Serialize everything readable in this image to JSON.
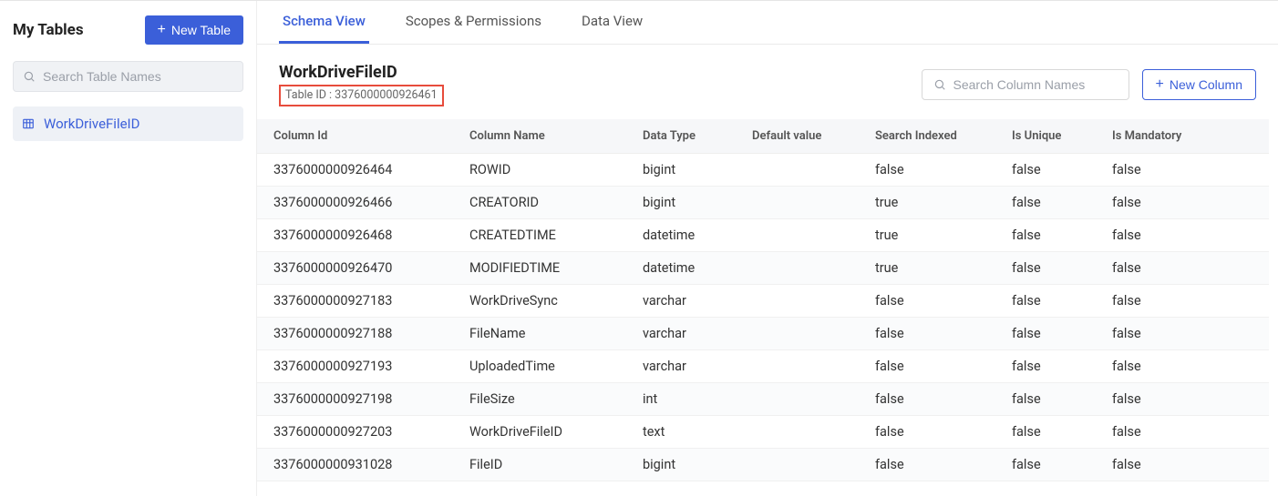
{
  "sidebar": {
    "title": "My Tables",
    "new_btn": "New Table",
    "search_placeholder": "Search Table Names",
    "items": [
      {
        "label": "WorkDriveFileID"
      }
    ]
  },
  "tabs": [
    {
      "label": "Schema View",
      "active": true
    },
    {
      "label": "Scopes & Permissions",
      "active": false
    },
    {
      "label": "Data View",
      "active": false
    }
  ],
  "tableDetail": {
    "name": "WorkDriveFileID",
    "id_label": "Table ID : 3376000000926461"
  },
  "columnSearchPlaceholder": "Search Column Names",
  "newColumnBtn": "New Column",
  "columns": [
    "Column Id",
    "Column Name",
    "Data Type",
    "Default value",
    "Search Indexed",
    "Is Unique",
    "Is Mandatory"
  ],
  "rows": [
    {
      "id": "3376000000926464",
      "name": "ROWID",
      "type": "bigint",
      "default": "",
      "indexed": "false",
      "unique": "false",
      "mandatory": "false"
    },
    {
      "id": "3376000000926466",
      "name": "CREATORID",
      "type": "bigint",
      "default": "",
      "indexed": "true",
      "unique": "false",
      "mandatory": "false"
    },
    {
      "id": "3376000000926468",
      "name": "CREATEDTIME",
      "type": "datetime",
      "default": "",
      "indexed": "true",
      "unique": "false",
      "mandatory": "false"
    },
    {
      "id": "3376000000926470",
      "name": "MODIFIEDTIME",
      "type": "datetime",
      "default": "",
      "indexed": "true",
      "unique": "false",
      "mandatory": "false"
    },
    {
      "id": "3376000000927183",
      "name": "WorkDriveSync",
      "type": "varchar",
      "default": "",
      "indexed": "false",
      "unique": "false",
      "mandatory": "false"
    },
    {
      "id": "3376000000927188",
      "name": "FileName",
      "type": "varchar",
      "default": "",
      "indexed": "false",
      "unique": "false",
      "mandatory": "false"
    },
    {
      "id": "3376000000927193",
      "name": "UploadedTime",
      "type": "varchar",
      "default": "",
      "indexed": "false",
      "unique": "false",
      "mandatory": "false"
    },
    {
      "id": "3376000000927198",
      "name": "FileSize",
      "type": "int",
      "default": "",
      "indexed": "false",
      "unique": "false",
      "mandatory": "false"
    },
    {
      "id": "3376000000927203",
      "name": "WorkDriveFileID",
      "type": "text",
      "default": "",
      "indexed": "false",
      "unique": "false",
      "mandatory": "false"
    },
    {
      "id": "3376000000931028",
      "name": "FileID",
      "type": "bigint",
      "default": "",
      "indexed": "false",
      "unique": "false",
      "mandatory": "false"
    }
  ]
}
